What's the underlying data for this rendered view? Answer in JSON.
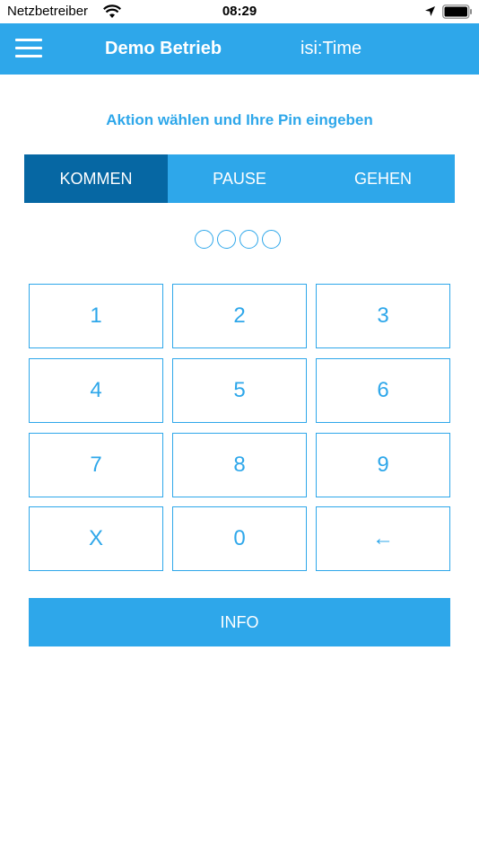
{
  "status_bar": {
    "carrier": "Netzbetreiber",
    "time": "08:29",
    "icons": [
      "wifi-icon",
      "location-icon",
      "battery-icon"
    ]
  },
  "nav": {
    "title": "Demo Betrieb",
    "app_name": "isi:Time",
    "menu_icon": "hamburger-menu-icon"
  },
  "instruction": "Aktion wählen und Ihre Pin eingeben",
  "actions": {
    "selected": "KOMMEN",
    "items": [
      {
        "label": "KOMMEN"
      },
      {
        "label": "PAUSE"
      },
      {
        "label": "GEHEN"
      }
    ]
  },
  "pin": {
    "length": 4,
    "entered": 0
  },
  "keypad": {
    "keys": [
      "1",
      "2",
      "3",
      "4",
      "5",
      "6",
      "7",
      "8",
      "9",
      "X",
      "0",
      "←"
    ]
  },
  "info_button": {
    "label": "INFO"
  },
  "colors": {
    "accent": "#2ea7ea",
    "active_segment": "#0667a3",
    "background": "#ffffff"
  }
}
